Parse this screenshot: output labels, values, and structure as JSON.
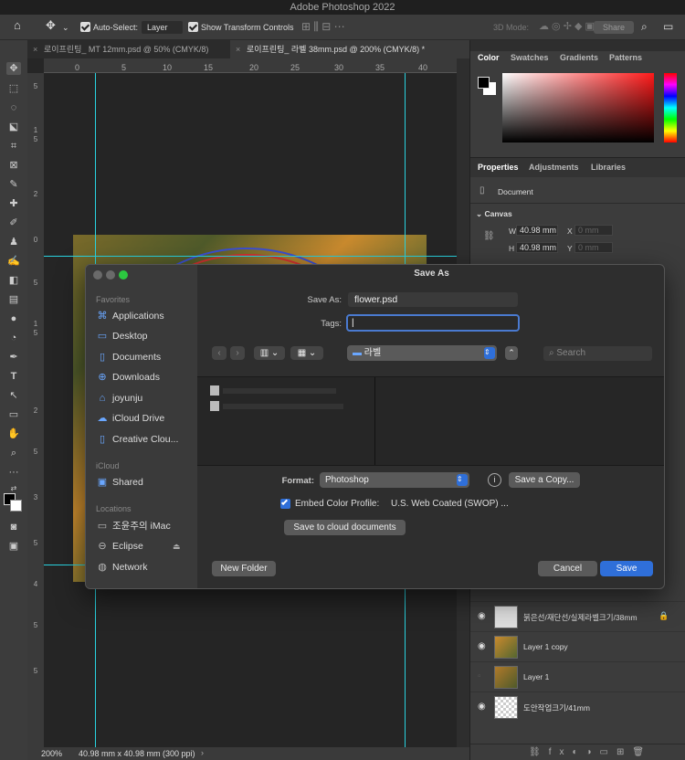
{
  "app": {
    "title": "Adobe Photoshop 2022"
  },
  "options": {
    "auto_select_label": "Auto-Select:",
    "auto_select_value": "Layer",
    "transform_label": "Show Transform Controls",
    "mode_label": "3D Mode:",
    "share_label": "Share"
  },
  "tabs": [
    {
      "label": "로이프린팅_ MT 12mm.psd @ 50% (CMYK/8)"
    },
    {
      "label": "로이프린팅_ 라벨 38mm.psd @ 200% (CMYK/8) *"
    }
  ],
  "rulers": {
    "top": [
      "0",
      "5",
      "10",
      "15",
      "20",
      "25",
      "30",
      "35",
      "40"
    ],
    "left": [
      "5",
      "1",
      "5",
      "2",
      "0",
      "5",
      "1",
      "5",
      "2",
      "5",
      "3",
      "5",
      "4",
      "5",
      "5"
    ]
  },
  "status": {
    "zoom": "200%",
    "doc_info": "40.98 mm x 40.98 mm (300 ppi)"
  },
  "color_panel": {
    "tabs": [
      "Color",
      "Swatches",
      "Gradients",
      "Patterns"
    ]
  },
  "properties_panel": {
    "tabs": [
      "Properties",
      "Adjustments",
      "Libraries"
    ],
    "kind": "Document",
    "section": "Canvas",
    "w_label": "W",
    "w_value": "40.98 mm",
    "h_label": "H",
    "h_value": "40.98 mm",
    "x_label": "X",
    "x_value": "0 mm",
    "y_label": "Y",
    "y_value": "0 mm"
  },
  "layers": [
    {
      "name": "붉은선/재단선/실제라벨크기/38mm"
    },
    {
      "name": "Layer 1 copy"
    },
    {
      "name": "Layer 1"
    },
    {
      "name": "도안작업크기/41mm"
    }
  ],
  "dialog": {
    "title": "Save As",
    "save_as_label": "Save As:",
    "save_as_value": "flower.psd",
    "tags_label": "Tags:",
    "tags_value": "",
    "folder": "라벨",
    "search_placeholder": "Search",
    "format_label": "Format:",
    "format_value": "Photoshop",
    "save_copy_label": "Save a Copy...",
    "embed_label": "Embed Color Profile:",
    "embed_value": "U.S. Web Coated (SWOP) ...",
    "cloud_label": "Save to cloud documents",
    "new_folder_label": "New Folder",
    "cancel_label": "Cancel",
    "save_label": "Save",
    "sidebar": {
      "favorites_head": "Favorites",
      "favorites": [
        {
          "label": "Applications",
          "icon": "applications-icon"
        },
        {
          "label": "Desktop",
          "icon": "desktop-icon"
        },
        {
          "label": "Documents",
          "icon": "documents-icon"
        },
        {
          "label": "Downloads",
          "icon": "downloads-icon"
        },
        {
          "label": "joyunju",
          "icon": "home-icon"
        },
        {
          "label": "iCloud Drive",
          "icon": "cloud-icon"
        },
        {
          "label": "Creative Clou...",
          "icon": "document-icon"
        }
      ],
      "icloud_head": "iCloud",
      "icloud": [
        {
          "label": "Shared",
          "icon": "shared-folder-icon"
        }
      ],
      "locations_head": "Locations",
      "locations": [
        {
          "label": "조윤주의 iMac",
          "icon": "computer-icon"
        },
        {
          "label": "Eclipse",
          "icon": "disk-icon"
        },
        {
          "label": "Network",
          "icon": "network-icon"
        }
      ]
    }
  }
}
